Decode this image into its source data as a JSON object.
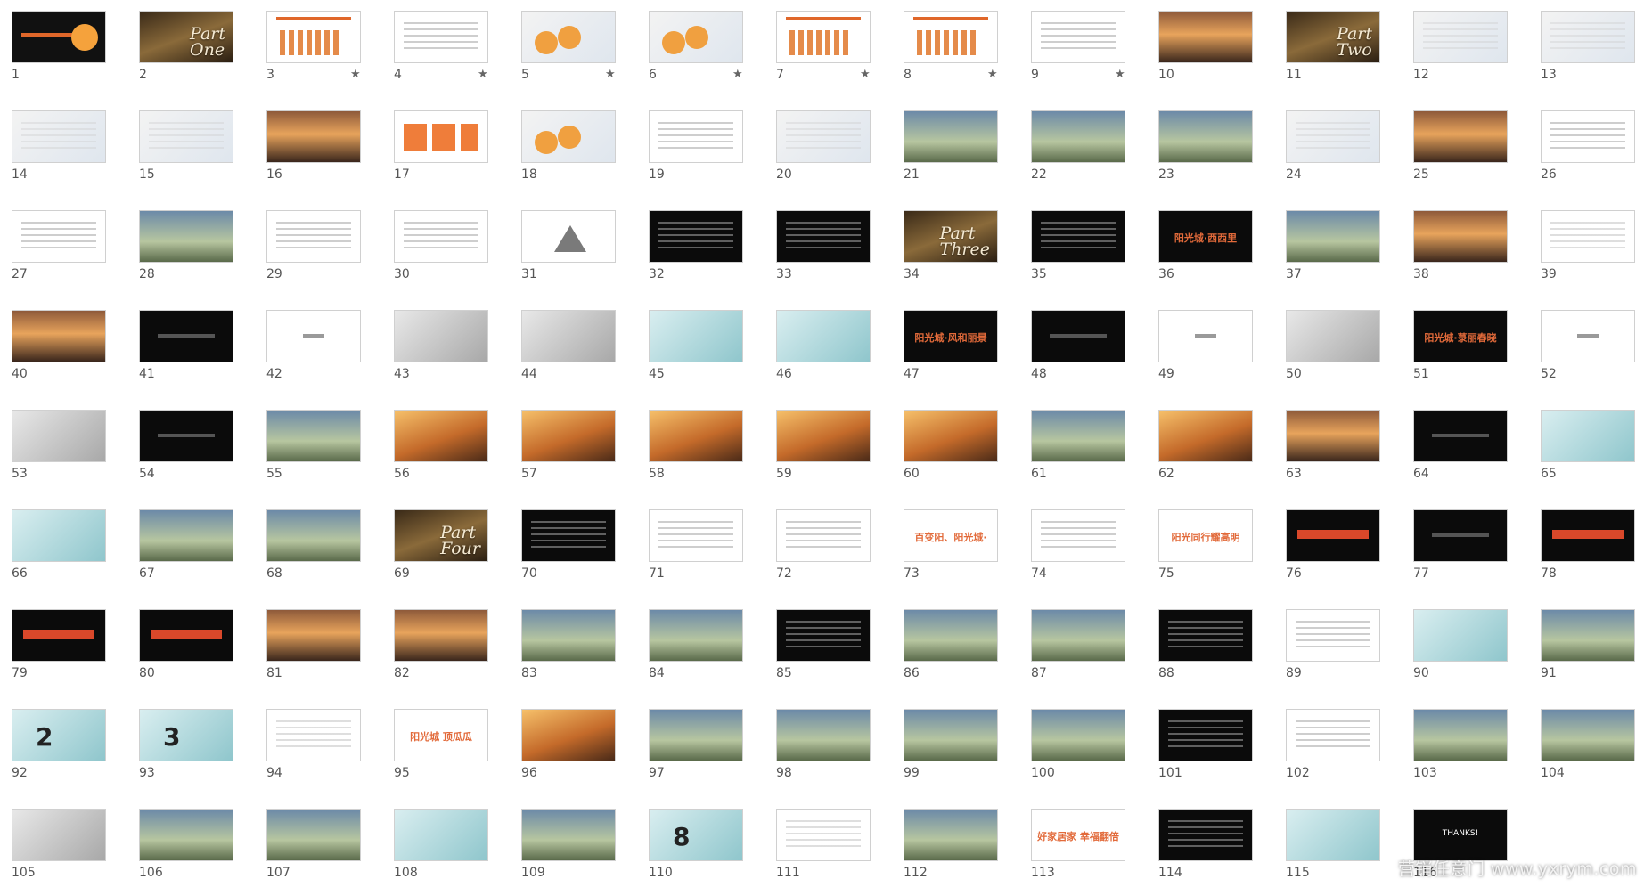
{
  "watermark": "营销任意门 www.yxrym.com",
  "slides": [
    {
      "n": "1",
      "style": "warm-circle",
      "star": false
    },
    {
      "n": "2",
      "style": "part",
      "label": "Part\nOne",
      "star": false
    },
    {
      "n": "3",
      "style": "chart",
      "star": true
    },
    {
      "n": "4",
      "style": "table",
      "star": true
    },
    {
      "n": "5",
      "style": "map-orange",
      "star": true
    },
    {
      "n": "6",
      "style": "map-orange",
      "star": true
    },
    {
      "n": "7",
      "style": "chart",
      "star": true
    },
    {
      "n": "8",
      "style": "chart",
      "star": true
    },
    {
      "n": "9",
      "style": "table",
      "star": true
    },
    {
      "n": "10",
      "style": "sunset",
      "star": false
    },
    {
      "n": "11",
      "style": "part",
      "label": "Part\nTwo",
      "star": false
    },
    {
      "n": "12",
      "style": "map",
      "star": false
    },
    {
      "n": "13",
      "style": "map",
      "star": false
    },
    {
      "n": "14",
      "style": "map",
      "star": false
    },
    {
      "n": "15",
      "style": "map",
      "star": false
    },
    {
      "n": "16",
      "style": "sunset",
      "star": false
    },
    {
      "n": "17",
      "style": "orange-boxes",
      "star": false
    },
    {
      "n": "18",
      "style": "map-orange",
      "star": false
    },
    {
      "n": "19",
      "style": "table",
      "star": false
    },
    {
      "n": "20",
      "style": "map",
      "star": false
    },
    {
      "n": "21",
      "style": "photo",
      "star": false
    },
    {
      "n": "22",
      "style": "photo",
      "star": false
    },
    {
      "n": "23",
      "style": "photo",
      "star": false
    },
    {
      "n": "24",
      "style": "map",
      "star": false
    },
    {
      "n": "25",
      "style": "sunset",
      "star": false
    },
    {
      "n": "26",
      "style": "table",
      "star": false
    },
    {
      "n": "27",
      "style": "table",
      "star": false
    },
    {
      "n": "28",
      "style": "photo",
      "star": false
    },
    {
      "n": "29",
      "style": "table",
      "star": false
    },
    {
      "n": "30",
      "style": "table",
      "star": false
    },
    {
      "n": "31",
      "style": "triangle",
      "star": false
    },
    {
      "n": "32",
      "style": "dark-text",
      "star": false
    },
    {
      "n": "33",
      "style": "dark-text",
      "star": false
    },
    {
      "n": "34",
      "style": "part",
      "label": "Part\nThree",
      "star": false
    },
    {
      "n": "35",
      "style": "dark-text",
      "star": false
    },
    {
      "n": "36",
      "style": "dark-red",
      "text": "阳光城·西西里",
      "star": false
    },
    {
      "n": "37",
      "style": "photo",
      "star": false
    },
    {
      "n": "38",
      "style": "sunset",
      "star": false
    },
    {
      "n": "39",
      "style": "light-text",
      "star": false
    },
    {
      "n": "40",
      "style": "sunset",
      "star": false
    },
    {
      "n": "41",
      "style": "dark",
      "star": false
    },
    {
      "n": "42",
      "style": "light-logo",
      "star": false
    },
    {
      "n": "43",
      "style": "gray",
      "star": false
    },
    {
      "n": "44",
      "style": "gray",
      "star": false
    },
    {
      "n": "45",
      "style": "teal",
      "star": false
    },
    {
      "n": "46",
      "style": "teal",
      "star": false
    },
    {
      "n": "47",
      "style": "dark-red",
      "text": "阳光城·风和丽景",
      "star": false
    },
    {
      "n": "48",
      "style": "dark",
      "star": false
    },
    {
      "n": "49",
      "style": "light-logo",
      "star": false
    },
    {
      "n": "50",
      "style": "gray",
      "star": false
    },
    {
      "n": "51",
      "style": "dark-red",
      "text": "阳光城·菉丽春晓",
      "star": false
    },
    {
      "n": "52",
      "style": "light-logo",
      "star": false
    },
    {
      "n": "53",
      "style": "gray",
      "star": false
    },
    {
      "n": "54",
      "style": "dark",
      "star": false
    },
    {
      "n": "55",
      "style": "photo",
      "star": false
    },
    {
      "n": "56",
      "style": "warm",
      "star": false
    },
    {
      "n": "57",
      "style": "warm",
      "star": false
    },
    {
      "n": "58",
      "style": "warm",
      "star": false
    },
    {
      "n": "59",
      "style": "warm",
      "star": false
    },
    {
      "n": "60",
      "style": "warm",
      "star": false
    },
    {
      "n": "61",
      "style": "photo",
      "star": false
    },
    {
      "n": "62",
      "style": "warm",
      "star": false
    },
    {
      "n": "63",
      "style": "sunset",
      "star": false
    },
    {
      "n": "64",
      "style": "dark",
      "star": false
    },
    {
      "n": "65",
      "style": "teal",
      "star": false
    },
    {
      "n": "66",
      "style": "teal",
      "star": false
    },
    {
      "n": "67",
      "style": "photo",
      "star": false
    },
    {
      "n": "68",
      "style": "photo",
      "star": false
    },
    {
      "n": "69",
      "style": "part",
      "label": "Part\nFour",
      "star": false
    },
    {
      "n": "70",
      "style": "dark-text",
      "star": false
    },
    {
      "n": "71",
      "style": "table",
      "star": false
    },
    {
      "n": "72",
      "style": "table",
      "star": false
    },
    {
      "n": "73",
      "style": "light-red",
      "text": "百变阳、阳光城·",
      "star": false
    },
    {
      "n": "74",
      "style": "table",
      "star": false
    },
    {
      "n": "75",
      "style": "light-red",
      "text": "阳光同行耀高明",
      "star": false
    },
    {
      "n": "76",
      "style": "dark-red-band",
      "star": false
    },
    {
      "n": "77",
      "style": "dark",
      "star": false
    },
    {
      "n": "78",
      "style": "dark-red-band",
      "star": false
    },
    {
      "n": "79",
      "style": "dark-red-band",
      "star": false
    },
    {
      "n": "80",
      "style": "dark-red-band",
      "star": false
    },
    {
      "n": "81",
      "style": "sunset",
      "star": false
    },
    {
      "n": "82",
      "style": "sunset",
      "star": false
    },
    {
      "n": "83",
      "style": "photo",
      "star": false
    },
    {
      "n": "84",
      "style": "photo",
      "star": false
    },
    {
      "n": "85",
      "style": "dark-text",
      "star": false
    },
    {
      "n": "86",
      "style": "photo",
      "star": false
    },
    {
      "n": "87",
      "style": "photo",
      "star": false
    },
    {
      "n": "88",
      "style": "dark-text",
      "star": false
    },
    {
      "n": "89",
      "style": "table",
      "star": false
    },
    {
      "n": "90",
      "style": "teal",
      "star": false
    },
    {
      "n": "91",
      "style": "photo",
      "star": false
    },
    {
      "n": "92",
      "style": "teal-digit",
      "digit": "2",
      "star": false
    },
    {
      "n": "93",
      "style": "teal-digit",
      "digit": "3",
      "star": false
    },
    {
      "n": "94",
      "style": "light-text",
      "star": false
    },
    {
      "n": "95",
      "style": "light-red",
      "text": "阳光城 顶瓜瓜",
      "star": false
    },
    {
      "n": "96",
      "style": "warm",
      "star": false
    },
    {
      "n": "97",
      "style": "photo",
      "star": false
    },
    {
      "n": "98",
      "style": "photo",
      "star": false
    },
    {
      "n": "99",
      "style": "photo",
      "star": false
    },
    {
      "n": "100",
      "style": "photo",
      "star": false
    },
    {
      "n": "101",
      "style": "dark-text",
      "star": false
    },
    {
      "n": "102",
      "style": "table",
      "star": false
    },
    {
      "n": "103",
      "style": "photo",
      "star": false
    },
    {
      "n": "104",
      "style": "photo",
      "star": false
    },
    {
      "n": "105",
      "style": "gray",
      "star": false
    },
    {
      "n": "106",
      "style": "photo",
      "star": false
    },
    {
      "n": "107",
      "style": "photo",
      "star": false
    },
    {
      "n": "108",
      "style": "teal",
      "star": false
    },
    {
      "n": "109",
      "style": "photo",
      "star": false
    },
    {
      "n": "110",
      "style": "teal-digit",
      "digit": "8",
      "star": false
    },
    {
      "n": "111",
      "style": "light-text",
      "star": false
    },
    {
      "n": "112",
      "style": "photo",
      "star": false
    },
    {
      "n": "113",
      "style": "light-red",
      "text": "好家居家 幸福翻倍",
      "star": false
    },
    {
      "n": "114",
      "style": "dark-text",
      "star": false
    },
    {
      "n": "115",
      "style": "teal",
      "star": false
    },
    {
      "n": "116",
      "style": "dark-center",
      "text": "THANKS!",
      "star": false
    }
  ]
}
